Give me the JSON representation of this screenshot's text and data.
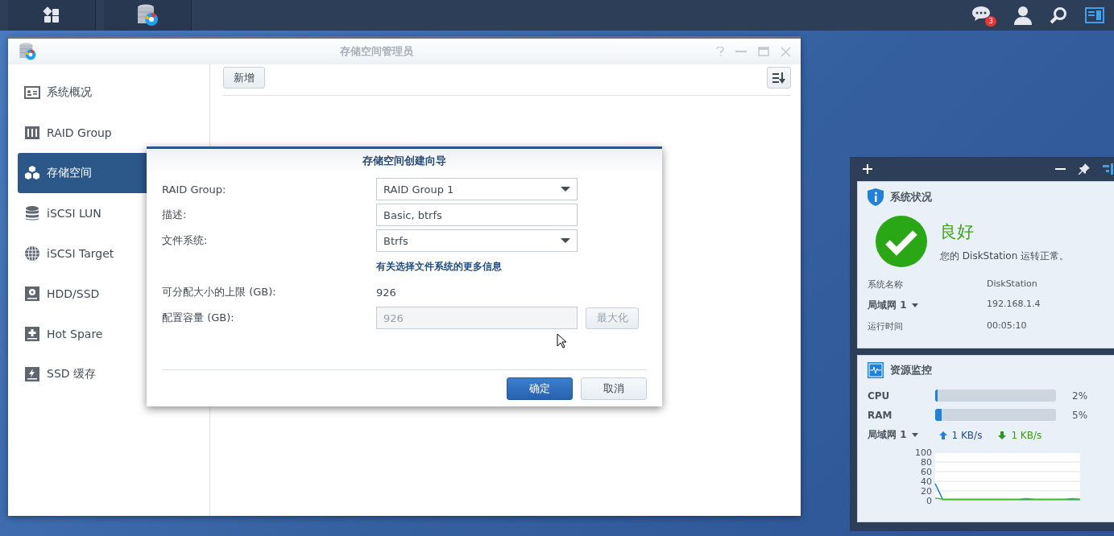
{
  "taskbar": {
    "buttons": [
      {
        "kind": "main-menu"
      },
      {
        "kind": "storage-app"
      }
    ],
    "notification_count": "3"
  },
  "window": {
    "title": "存储空间管理员",
    "sidebar": {
      "items": [
        {
          "label": "系统概况",
          "kind": "overview",
          "selected": false
        },
        {
          "label": "RAID Group",
          "kind": "raid",
          "selected": false
        },
        {
          "label": "存储空间",
          "kind": "cubes",
          "selected": true
        },
        {
          "label": "iSCSI LUN",
          "kind": "database",
          "selected": false
        },
        {
          "label": "iSCSI Target",
          "kind": "globe",
          "selected": false
        },
        {
          "label": "HDD/SSD",
          "kind": "disk",
          "selected": false
        },
        {
          "label": "Hot Spare",
          "kind": "plus",
          "selected": false
        },
        {
          "label": "SSD 缓存",
          "kind": "bolt",
          "selected": false
        }
      ]
    },
    "toolbar": {
      "create_button": "新增"
    }
  },
  "dialog": {
    "title": "存储空间创建向导",
    "rows": [
      {
        "kind": "select",
        "label": "RAID Group:",
        "value": "RAID Group 1"
      },
      {
        "kind": "text",
        "label": "描述:",
        "value": "Basic, btrfs"
      },
      {
        "kind": "select",
        "label": "文件系统:",
        "value": "Btrfs"
      },
      {
        "kind": "link",
        "text": "有关选择文件系统的更多信息"
      },
      {
        "kind": "static",
        "label": "可分配大小的上限 (GB):",
        "value": "926"
      },
      {
        "kind": "capacity",
        "label": "配置容量 (GB):",
        "value": "926",
        "disabled": true,
        "button": "最大化"
      }
    ],
    "buttons": [
      {
        "label": "确定",
        "kind": "primary"
      },
      {
        "label": "取消",
        "kind": "secondary"
      }
    ]
  },
  "widgets": {
    "status": {
      "title": "系统状况",
      "state": "良好",
      "message": "您的 DiskStation 运转正常。",
      "rows": [
        {
          "label": "系统名称",
          "value": "DiskStation",
          "dropdown": false
        },
        {
          "label": "局域网 1",
          "value": "192.168.1.4",
          "dropdown": true
        },
        {
          "label": "运行时间",
          "value": "00:05:10",
          "dropdown": false
        }
      ]
    },
    "resource": {
      "title": "资源监控",
      "meters": [
        {
          "label": "CPU",
          "level": 0.02,
          "reading": "2%"
        },
        {
          "label": "RAM",
          "level": 0.05,
          "reading": "5%"
        }
      ],
      "network": {
        "label": "局域网 1",
        "upload": "1 KB/s",
        "download": "1 KB/s"
      },
      "chart_data": {
        "type": "line",
        "grid": true,
        "ylim": [
          0,
          100
        ],
        "yticks": [
          0,
          20,
          40,
          60,
          80,
          100
        ],
        "series": [
          {
            "color": "#1a7fd4",
            "values": [
              35,
              2,
              2,
              2,
              2,
              2,
              2,
              2,
              2,
              2,
              2,
              2,
              2,
              2,
              2,
              2,
              2,
              2,
              2,
              2
            ]
          },
          {
            "color": "#3cbf2a",
            "values": [
              5,
              3,
              3,
              3,
              3,
              3,
              3,
              3,
              3,
              3,
              3,
              3,
              4,
              3,
              3,
              3,
              3,
              3,
              4,
              3
            ]
          }
        ]
      }
    }
  }
}
